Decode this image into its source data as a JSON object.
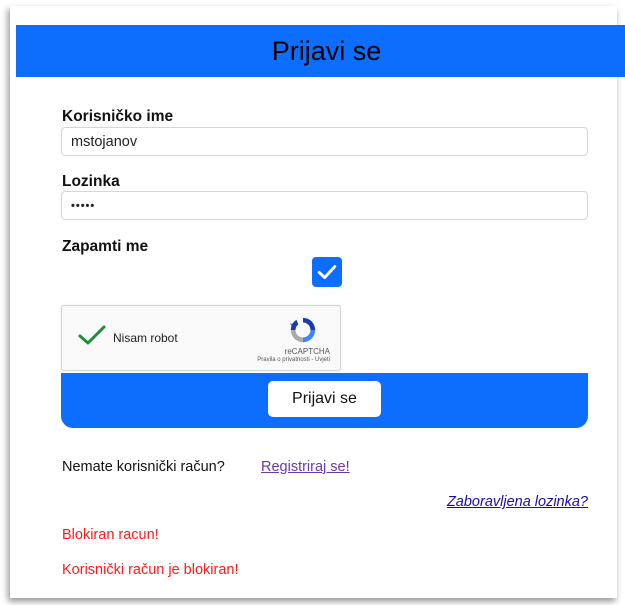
{
  "header": {
    "title": "Prijavi se"
  },
  "form": {
    "username_label": "Korisničko ime",
    "username_value": "mstojanov",
    "password_label": "Lozinka",
    "password_value": "•••••",
    "remember_label": "Zapamti me",
    "remember_checked": true,
    "submit_label": "Prijavi se"
  },
  "recaptcha": {
    "label": "Nisam robot",
    "brand": "reCAPTCHA",
    "links": "Pravila o privatnosti - Uvjeti"
  },
  "links": {
    "no_account_text": "Nemate korisnički račun?",
    "register_label": "Registriraj se!",
    "forgot_label": "Zaboravljena lozinka?"
  },
  "errors": {
    "blocked_short": "Blokiran racun!",
    "blocked_long": "Korisnički račun je blokiran!"
  },
  "colors": {
    "primary": "#0d6efd",
    "error": "#ff1a1a",
    "check": "#1e8e3e"
  }
}
